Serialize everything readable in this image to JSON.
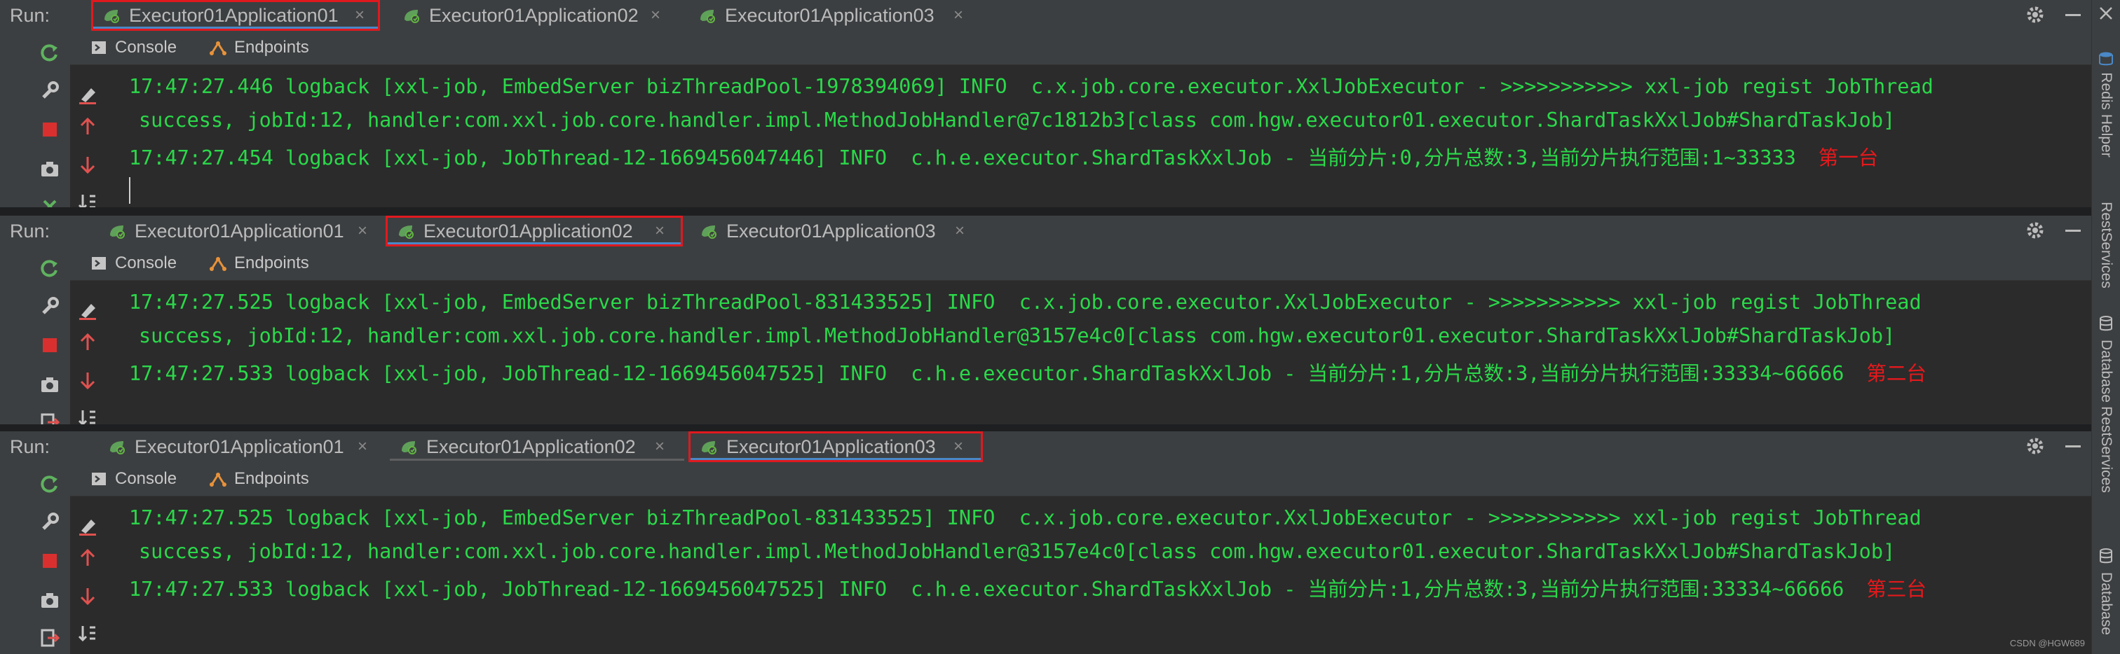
{
  "run_label": "Run:",
  "tabs": [
    {
      "label": "Executor01Application01"
    },
    {
      "label": "Executor01Application02"
    },
    {
      "label": "Executor01Application03"
    }
  ],
  "close_glyph": "×",
  "subtabs": {
    "console": "Console",
    "endpoints": "Endpoints"
  },
  "panels": [
    {
      "lines": [
        "17:47:27.446 logback [xxl-job, EmbedServer bizThreadPool-1978394069] INFO  c.x.job.core.executor.XxlJobExecutor - >>>>>>>>>>> xxl-job regist JobThread",
        "success, jobId:12, handler:com.xxl.job.core.handler.impl.MethodJobHandler@7c1812b3[class com.hgw.executor01.executor.ShardTaskXxlJob#ShardTaskJob]",
        "17:47:27.454 logback [xxl-job, JobThread-12-1669456047446] INFO  c.h.e.executor.ShardTaskXxlJob - 当前分片:0,分片总数:3,当前分片执行范围:1~33333"
      ],
      "annotation": "第一台"
    },
    {
      "lines": [
        "17:47:27.525 logback [xxl-job, EmbedServer bizThreadPool-831433525] INFO  c.x.job.core.executor.XxlJobExecutor - >>>>>>>>>>> xxl-job regist JobThread",
        "success, jobId:12, handler:com.xxl.job.core.handler.impl.MethodJobHandler@3157e4c0[class com.hgw.executor01.executor.ShardTaskXxlJob#ShardTaskJob]",
        "17:47:27.533 logback [xxl-job, JobThread-12-1669456047525] INFO  c.h.e.executor.ShardTaskXxlJob - 当前分片:1,分片总数:3,当前分片执行范围:33334~66666"
      ],
      "annotation": "第二台"
    },
    {
      "lines": [
        "17:47:27.525 logback [xxl-job, EmbedServer bizThreadPool-831433525] INFO  c.x.job.core.executor.XxlJobExecutor - >>>>>>>>>>> xxl-job regist JobThread",
        "success, jobId:12, handler:com.xxl.job.core.handler.impl.MethodJobHandler@3157e4c0[class com.hgw.executor01.executor.ShardTaskXxlJob#ShardTaskJob]",
        "17:47:27.533 logback [xxl-job, JobThread-12-1669456047525] INFO  c.h.e.executor.ShardTaskXxlJob - 当前分片:1,分片总数:3,当前分片执行范围:33334~66666"
      ],
      "annotation": "第三台"
    }
  ],
  "side_tools": {
    "redis": "Redis Helper",
    "rest": "RestServices",
    "database": "Database"
  },
  "watermark": "CSDN @HGW689",
  "colors": {
    "log_green": "#2bd94a",
    "annotation_red": "#e5191c",
    "highlight_border": "#e0191f",
    "active_tab_underline": "#4a88c7"
  }
}
